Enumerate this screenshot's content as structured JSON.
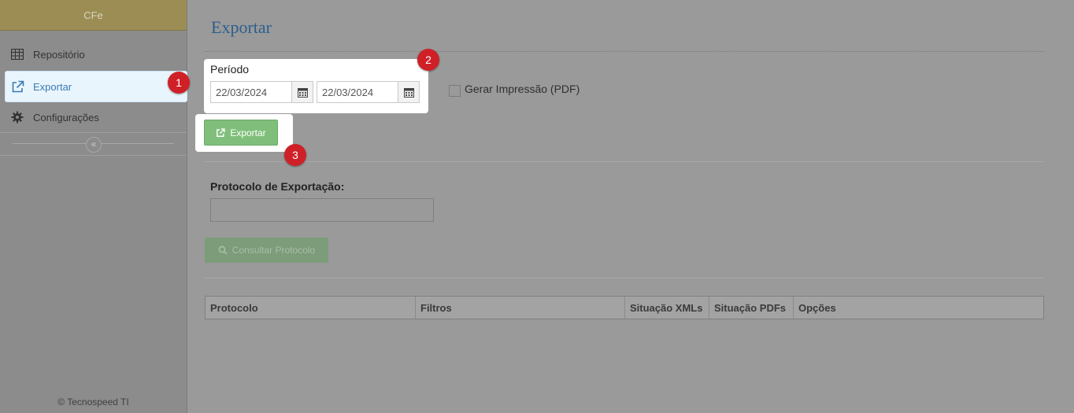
{
  "sidebar": {
    "brand": "CFe",
    "items": [
      {
        "label": "Repositório",
        "icon": "table-icon"
      },
      {
        "label": "Exportar",
        "icon": "external-link-icon",
        "active": true
      },
      {
        "label": "Configurações",
        "icon": "gear-icon"
      }
    ],
    "collapse_icon": "double-chevron-left-icon",
    "footer": "© Tecnospeed TI"
  },
  "main": {
    "title": "Exportar",
    "period": {
      "label": "Período",
      "start_date": "22/03/2024",
      "end_date": "22/03/2024"
    },
    "print_checkbox": {
      "label": "Gerar Impressão (PDF)",
      "checked": false
    },
    "export_button": "Exportar",
    "protocol": {
      "label": "Protocolo de Exportação:",
      "value": "",
      "consult_button": "Consultar Protocolo"
    },
    "table": {
      "columns": [
        "Protocolo",
        "Filtros",
        "Situação XMLs",
        "Situação PDFs",
        "Opções"
      ]
    }
  },
  "annotations": [
    "1",
    "2",
    "3"
  ],
  "colors": {
    "accent_blue": "#3a7ab4",
    "title_blue": "#2e5e8e",
    "brand_gold": "#9c8d54",
    "button_green": "#7fbf7b",
    "badge_red": "#cf2027"
  }
}
